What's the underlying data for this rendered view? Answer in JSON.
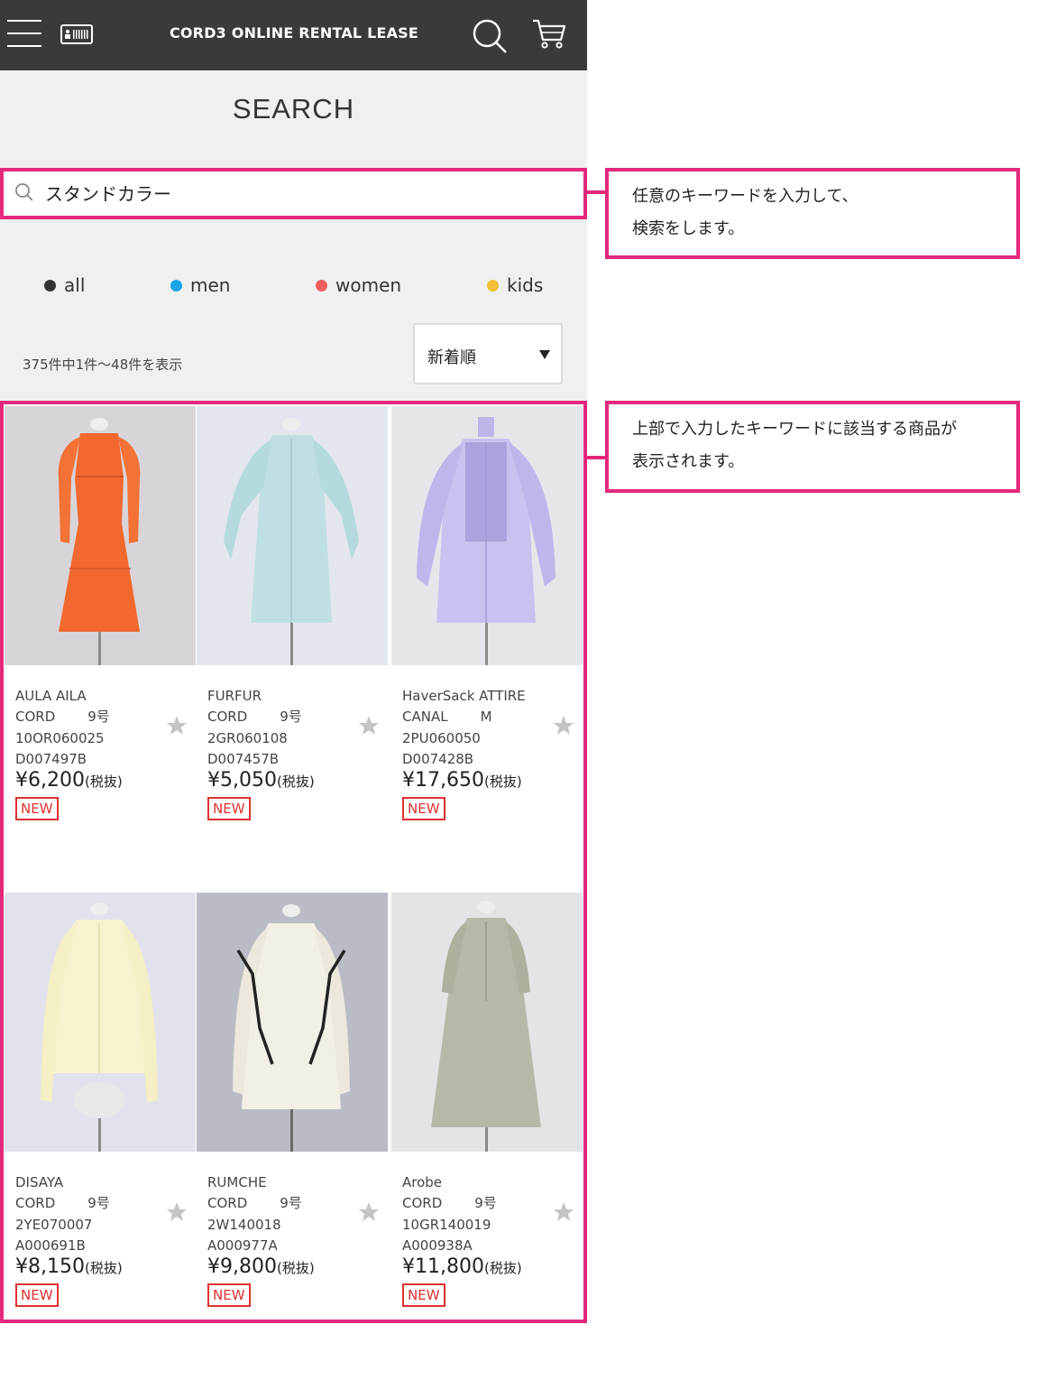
{
  "header": {
    "title": "CORD3 ONLINE RENTAL LEASE"
  },
  "page": {
    "title": "SEARCH"
  },
  "search": {
    "value": "スタンドカラー",
    "placeholder": ""
  },
  "filters": [
    {
      "label": "all",
      "color": "#333333"
    },
    {
      "label": "men",
      "color": "#1aa5e8"
    },
    {
      "label": "women",
      "color": "#ef5e5e"
    },
    {
      "label": "kids",
      "color": "#f2c035"
    }
  ],
  "results": {
    "count_text": "375件中1件〜48件を表示"
  },
  "sort": {
    "selected": "新着順"
  },
  "products": [
    {
      "brand": "AULA AILA",
      "line": "CORD",
      "size": "9号",
      "code": "10OR060025",
      "id": "D007497B",
      "price": "¥6,200",
      "tax": "(税抜)",
      "badge": "NEW"
    },
    {
      "brand": "FURFUR",
      "line": "CORD",
      "size": "9号",
      "code": "2GR060108",
      "id": "D007457B",
      "price": "¥5,050",
      "tax": "(税抜)",
      "badge": "NEW"
    },
    {
      "brand": "HaverSack ATTIRE",
      "line": "CANAL",
      "size": "M",
      "code": "2PU060050",
      "id": "D007428B",
      "price": "¥17,650",
      "tax": "(税抜)",
      "badge": "NEW"
    },
    {
      "brand": "DISAYA",
      "line": "CORD",
      "size": "9号",
      "code": "2YE070007",
      "id": "A000691B",
      "price": "¥8,150",
      "tax": "(税抜)",
      "badge": "NEW"
    },
    {
      "brand": "RUMCHE",
      "line": "CORD",
      "size": "9号",
      "code": "2W140018",
      "id": "A000977A",
      "price": "¥9,800",
      "tax": "(税抜)",
      "badge": "NEW"
    },
    {
      "brand": "Arobe",
      "line": "CORD",
      "size": "9号",
      "code": "10GR140019",
      "id": "A000938A",
      "price": "¥11,800",
      "tax": "(税抜)",
      "badge": "NEW"
    }
  ],
  "annotations": [
    {
      "line1": "任意のキーワードを入力して、",
      "line2": "検索をします。"
    },
    {
      "line1": "上部で入力したキーワードに該当する商品が",
      "line2": "表示されます。"
    }
  ],
  "colors": {
    "header_bg": "#3a3a3a",
    "highlight": "#e4287c",
    "new_badge": "#e03030"
  }
}
